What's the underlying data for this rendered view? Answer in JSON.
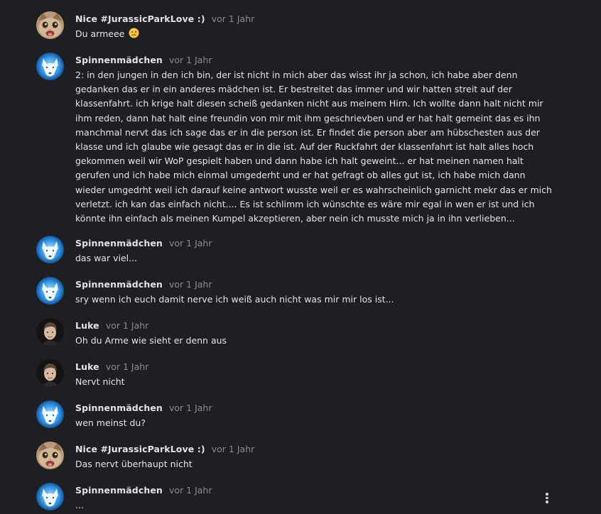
{
  "messages": [
    {
      "author": "Nice #JurassicParkLove :)",
      "time": "vor 1 Jahr",
      "avatar": "cat-avatar",
      "lines": [
        "Du armeee"
      ],
      "emoji": "sad-face-emoji"
    },
    {
      "author": "Spinnenmädchen",
      "time": "vor 1 Jahr",
      "avatar": "wolf-avatar",
      "lines": [
        "2: in den jungen in den ich bin, der ist nicht in mich aber das wisst ihr ja schon, ich habe aber denn",
        "gedanken das er in ein anderes mädchen ist. Er bestreitet das immer und wir hatten streit auf der",
        "klassenfahrt. ich krige halt diesen scheiß gedanken nicht aus meinem Hirn. Ich wollte dann halt nicht mir",
        "ihm reden, dann hat halt eine freundin von mir mit ihm geschrievben und er hat halt gemeint das es ihn",
        "manchmal nervt das ich sage das er in die person ist. Er findet die person aber am hübschesten aus der",
        "klasse und ich glaube wie gesagt das er in die ist. Auf der Ruckfahrt der klassenfahrt ist halt alles hoch",
        "gekommen weil wir WoP gespielt haben und dann habe ich halt geweint... er hat meinen namen halt",
        "gerufen und ich habe mich einmal umgederht und er hat gefragt ob alles gut ist, ich habe mich dann",
        "wieder umgedrht weil ich darauf keine antwort wusste weil er es wahrscheinlich garnicht mekr das er mich",
        "verletzt. ich kan das einfach nicht.... Es ist schlimm ich wünschte es wäre mir egal in wen er ist und ich",
        "könnte ihn einfach als meinen Kumpel akzeptieren, aber nein ich musste mich ja in ihn verlieben..."
      ]
    },
    {
      "author": "Spinnenmädchen",
      "time": "vor 1 Jahr",
      "avatar": "wolf-avatar",
      "lines": [
        "das war viel..."
      ]
    },
    {
      "author": "Spinnenmädchen",
      "time": "vor 1 Jahr",
      "avatar": "wolf-avatar",
      "lines": [
        "sry wenn ich euch damit nerve ich weiß auch nicht was mir mir los ist..."
      ]
    },
    {
      "author": "Luke",
      "time": "vor 1 Jahr",
      "avatar": "person-avatar",
      "lines": [
        "Oh du Arme wie sieht er denn aus"
      ]
    },
    {
      "author": "Luke",
      "time": "vor 1 Jahr",
      "avatar": "person-avatar",
      "lines": [
        "Nervt nicht"
      ]
    },
    {
      "author": "Spinnenmädchen",
      "time": "vor 1 Jahr",
      "avatar": "wolf-avatar",
      "lines": [
        "wen meinst du?"
      ]
    },
    {
      "author": "Nice #JurassicParkLove :)",
      "time": "vor 1 Jahr",
      "avatar": "cat-avatar",
      "lines": [
        "Das nervt überhaupt nicht"
      ]
    },
    {
      "author": "Spinnenmädchen",
      "time": "vor 1 Jahr",
      "avatar": "wolf-avatar",
      "lines": [
        "..."
      ]
    }
  ],
  "more_menu_icon": "vertical-dots-icon",
  "colors": {
    "background": "#1e1f22",
    "author": "#e3e3e5",
    "timestamp": "#8b8c91",
    "text": "#e4e4e6"
  }
}
